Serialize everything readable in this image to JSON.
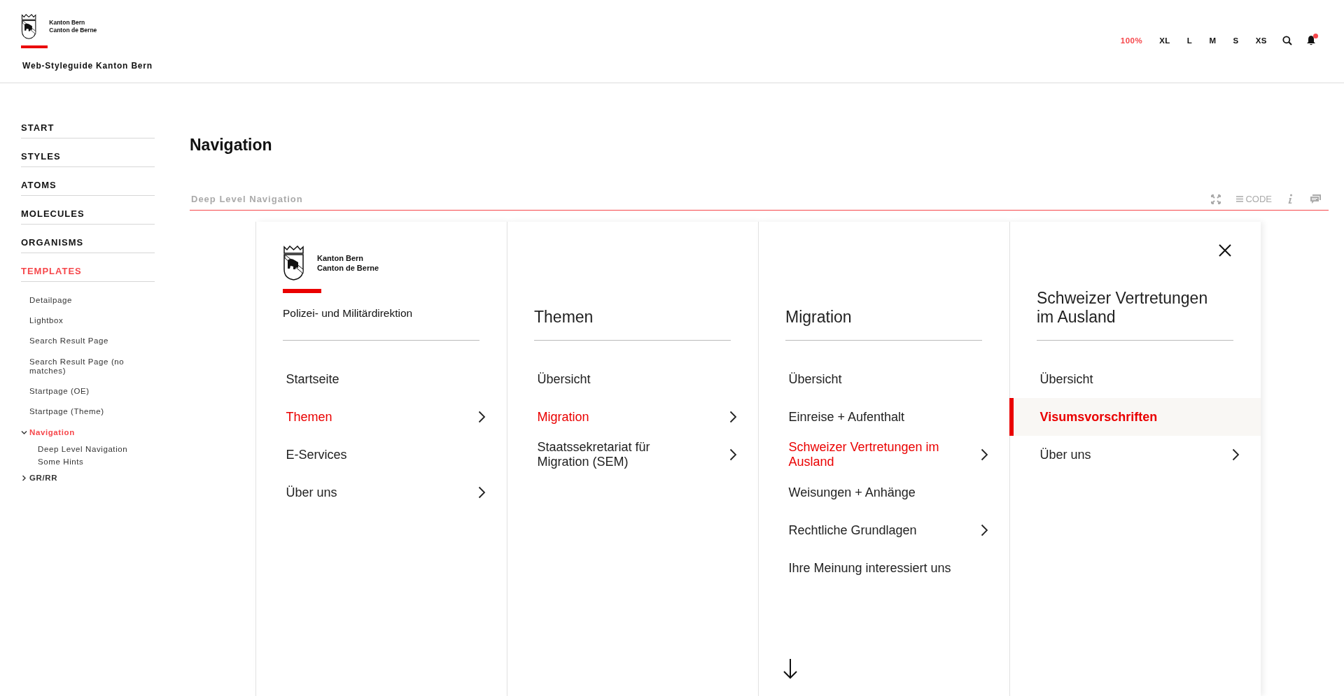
{
  "header": {
    "logo_lines": [
      "Kanton Bern",
      "Canton de Berne"
    ],
    "site_title": "Web-Styleguide Kanton Bern",
    "sizes": [
      {
        "label": "100%",
        "selected": true
      },
      {
        "label": "XL",
        "selected": false
      },
      {
        "label": "L",
        "selected": false
      },
      {
        "label": "M",
        "selected": false
      },
      {
        "label": "S",
        "selected": false
      },
      {
        "label": "XS",
        "selected": false
      }
    ],
    "notifications_unread": true
  },
  "sidebar": {
    "items": [
      {
        "label": "START",
        "selected": false
      },
      {
        "label": "STYLES",
        "selected": false
      },
      {
        "label": "ATOMS",
        "selected": false
      },
      {
        "label": "MOLECULES",
        "selected": false
      },
      {
        "label": "ORGANISMS",
        "selected": false
      },
      {
        "label": "TEMPLATES",
        "selected": true,
        "children": [
          {
            "label": "Detailpage",
            "selected": false
          },
          {
            "label": "Lightbox",
            "selected": false
          },
          {
            "label": "Search Result Page",
            "selected": false
          },
          {
            "label": "Search Result Page (no matches)",
            "selected": false
          },
          {
            "label": "Startpage (OE)",
            "selected": false
          },
          {
            "label": "Startpage (Theme)",
            "selected": false
          },
          {
            "label": "Navigation",
            "selected": true,
            "expanded": true,
            "children": [
              {
                "label": "Deep Level Navigation",
                "selected": false
              },
              {
                "label": "Some Hints",
                "selected": false
              }
            ]
          },
          {
            "label": "GR/RR",
            "selected": false,
            "expanded": false
          }
        ]
      }
    ]
  },
  "page_title": "Navigation",
  "demo": {
    "title": "Deep Level Navigation",
    "code_label": "CODE"
  },
  "panels": [
    {
      "kind": "brand",
      "logo_lines": [
        "Kanton Bern",
        "Canton de Berne"
      ],
      "title": "Polizei- und Militärdirektion",
      "active": false,
      "scroll_hint": false,
      "items": [
        {
          "label": "Startseite",
          "selected": false,
          "has_children": false
        },
        {
          "label": "Themen",
          "selected": true,
          "has_children": true
        },
        {
          "label": "E-Services",
          "selected": false,
          "has_children": false
        },
        {
          "label": "Über uns",
          "selected": false,
          "has_children": true
        }
      ]
    },
    {
      "kind": "list",
      "title": "Themen",
      "active": false,
      "scroll_hint": false,
      "items": [
        {
          "label": "Übersicht",
          "selected": false,
          "has_children": false
        },
        {
          "label": "Migration",
          "selected": true,
          "has_children": true
        },
        {
          "label": "Staatssekretariat für Migration (SEM)",
          "selected": false,
          "has_children": true
        }
      ]
    },
    {
      "kind": "list",
      "title": "Migration",
      "active": false,
      "scroll_hint": true,
      "items": [
        {
          "label": "Übersicht",
          "selected": false,
          "has_children": false
        },
        {
          "label": "Einreise + Aufenthalt",
          "selected": false,
          "has_children": false
        },
        {
          "label": "Schweizer Vertretungen im Ausland",
          "selected": true,
          "has_children": true
        },
        {
          "label": "Weisungen + Anhänge",
          "selected": false,
          "has_children": false
        },
        {
          "label": "Rechtliche Grundlagen",
          "selected": false,
          "has_children": true
        },
        {
          "label": "Ihre Meinung interessiert uns",
          "selected": false,
          "has_children": false
        }
      ]
    },
    {
      "kind": "list",
      "title": "Schweizer Vertretungen im Ausland",
      "active": true,
      "scroll_hint": false,
      "items": [
        {
          "label": "Übersicht",
          "selected": false,
          "has_children": false
        },
        {
          "label": "Visumsvorschriften",
          "selected": true,
          "has_children": false
        },
        {
          "label": "Über uns",
          "selected": false,
          "has_children": true
        }
      ]
    }
  ]
}
